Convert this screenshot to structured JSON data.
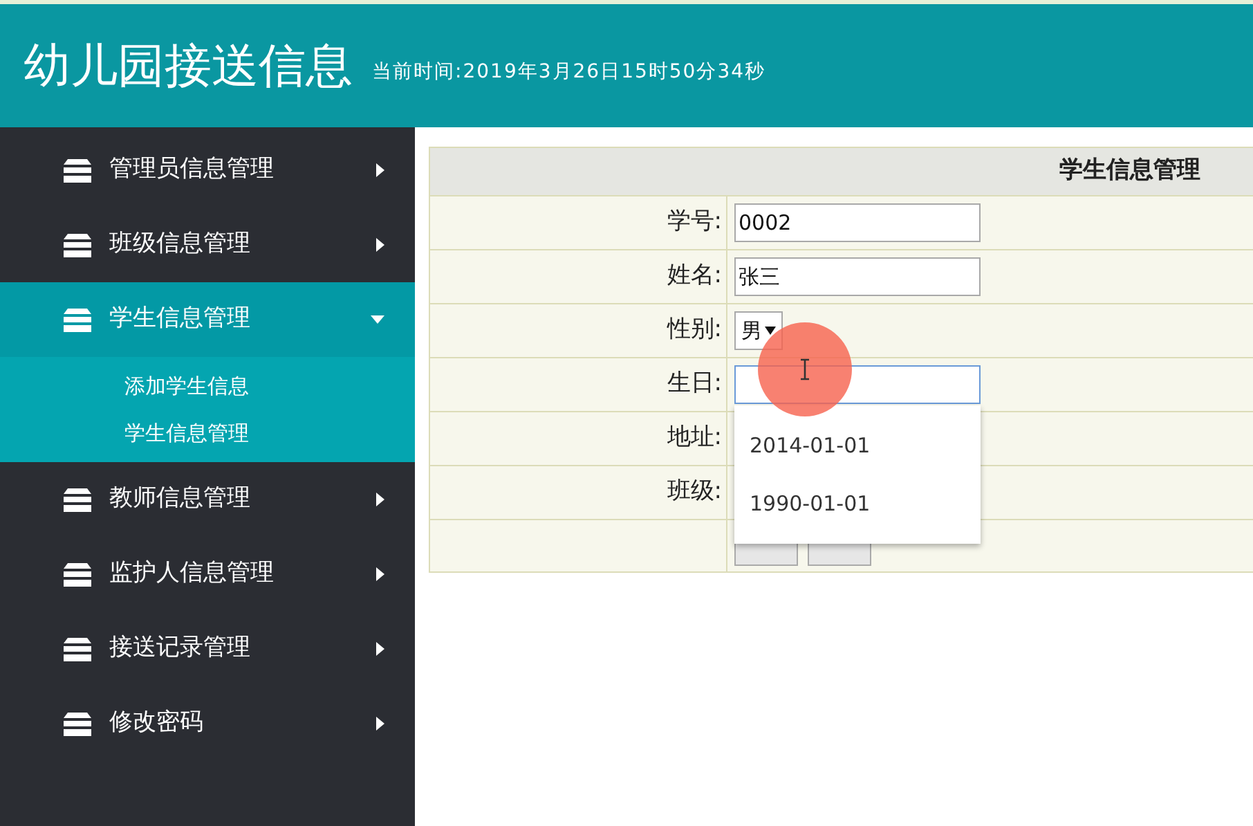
{
  "header": {
    "title": "幼儿园接送信息",
    "clock": "当前时间:2019年3月26日15时50分34秒"
  },
  "sidebar": {
    "items": [
      {
        "label": "管理员信息管理",
        "expanded": false
      },
      {
        "label": "班级信息管理",
        "expanded": false
      },
      {
        "label": "学生信息管理",
        "expanded": true,
        "children": [
          {
            "label": "添加学生信息"
          },
          {
            "label": "学生信息管理"
          }
        ]
      },
      {
        "label": "教师信息管理",
        "expanded": false
      },
      {
        "label": "监护人信息管理",
        "expanded": false
      },
      {
        "label": "接送记录管理",
        "expanded": false
      },
      {
        "label": "修改密码",
        "expanded": false
      }
    ]
  },
  "form": {
    "title": "学生信息管理",
    "fields": [
      {
        "label": "学号:",
        "kind": "text",
        "value": "0002",
        "focused": false
      },
      {
        "label": "姓名:",
        "kind": "text",
        "value": "张三",
        "focused": false
      },
      {
        "label": "性别:",
        "kind": "select",
        "value": "男"
      },
      {
        "label": "生日:",
        "kind": "text",
        "focused": true
      },
      {
        "label": "地址:",
        "kind": "hidden"
      },
      {
        "label": "班级:",
        "kind": "hidden"
      }
    ],
    "suggestions": [
      "2014-01-01",
      "1990-01-01"
    ]
  }
}
